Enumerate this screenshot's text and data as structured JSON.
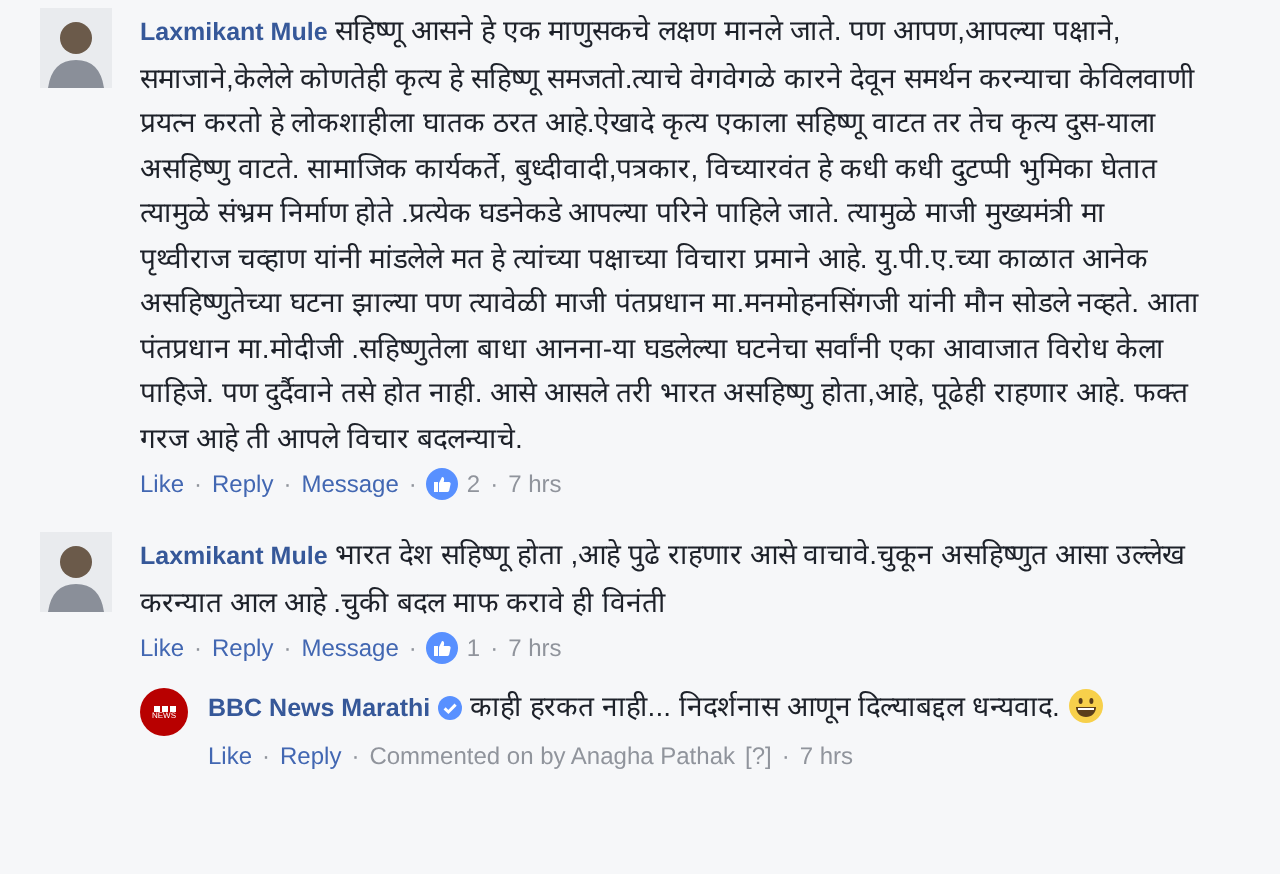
{
  "separator": "·",
  "comments": [
    {
      "author": "Laxmikant Mule",
      "text": "सहिष्णू आसने हे एक माणुसकचे लक्षण मानले जाते. पण आपण,आपल्या पक्षाने, समाजाने,केलेले कोणतेही कृत्य हे सहिष्णू समजतो.त्याचे वेगवेगळे कारने देवून समर्थन करन्याचा केविलवाणी प्रयत्न करतो हे लोकशाहीला घातक ठरत आहे.ऐखादे कृत्य एकाला सहिष्णू वाटत तर तेच कृत्य दुस-याला असहिष्णु वाटते. सामाजिक कार्यकर्ते, बुध्दीवादी,पत्रकार, विच्यारवंत हे कधी कधी दुटप्पी भुमिका घेतात त्यामुळे संभ्रम निर्माण होते .प्रत्येक घडनेकडे आपल्या परिने पाहिले जाते. त्यामुळे माजी मुख्यमंत्री मा पृथ्वीराज चव्हाण यांनी मांडलेले मत हे त्यांच्या पक्षाच्या विचारा प्रमाने आहे. यु.पी.ए.च्या काळात आनेक असहिष्णुतेच्या घटना झाल्या पण त्यावेळी माजी पंतप्रधान मा.मनमोहनसिंगजी यांनी मौन सोडले नव्हते. आता पंतप्रधान मा.मोदीजी .सहिष्णुतेला बाधा आनना-या घडलेल्या घटनेचा सर्वांनी एका आवाजात विरोध केला पाहिजे. पण दुर्दैवाने तसे होत नाही. आसे आसले तरी भारत असहिष्णु होता,आहे, पूढेही राहणार आहे. फक्त गरज आहे ती आपले विचार बदलन्याचे.",
      "actions": [
        "Like",
        "Reply",
        "Message"
      ],
      "likes": "2",
      "time": "7 hrs"
    },
    {
      "author": "Laxmikant Mule",
      "text": "भारत देश सहिष्णू होता ,आहे पुढे राहणार आसे वाचावे.चुकून असहिष्णुत आसा उल्लेख करन्यात आल आहे .चुकी बदल माफ करावे ही विनंती",
      "actions": [
        "Like",
        "Reply",
        "Message"
      ],
      "likes": "1",
      "time": "7 hrs",
      "children": [
        {
          "author": "BBC News Marathi",
          "verified": true,
          "avatar_text": "NEWS",
          "text": "काही हरकत नाही... निदर्शनास आणून दिल्याबद्दल धन्यवाद.",
          "emoji": true,
          "actions": [
            "Like",
            "Reply"
          ],
          "note": "Commented on by Anagha Pathak",
          "note_help": "[?]",
          "time": "7 hrs"
        }
      ]
    }
  ]
}
